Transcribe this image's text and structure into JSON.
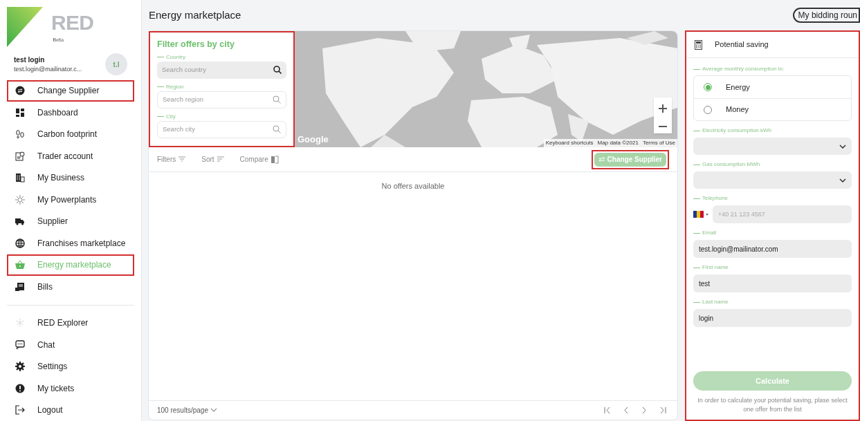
{
  "page_title": "Energy marketplace",
  "bidding_button": "My bidding roun",
  "logo": {
    "text": "RED",
    "subtitle": "Beta"
  },
  "user": {
    "name": "test login",
    "email": "test.login@mailinator.c...",
    "initials": "t.l"
  },
  "nav_sections": [
    {
      "items": [
        {
          "label": "Change Supplier",
          "selected": false,
          "highlighted": true
        },
        {
          "label": "Dashboard",
          "selected": false,
          "highlighted": false
        },
        {
          "label": "Carbon footprint",
          "selected": false,
          "highlighted": false
        },
        {
          "label": "Trader account",
          "selected": false,
          "highlighted": false
        },
        {
          "label": "My Business",
          "selected": false,
          "highlighted": false
        },
        {
          "label": "My Powerplants",
          "selected": false,
          "highlighted": false
        },
        {
          "label": "Supplier",
          "selected": false,
          "highlighted": false
        },
        {
          "label": "Franchises marketplace",
          "selected": false,
          "highlighted": false
        },
        {
          "label": "Energy marketplace",
          "selected": true,
          "highlighted": true
        },
        {
          "label": "Bills",
          "selected": false,
          "highlighted": false
        }
      ]
    },
    {
      "items": [
        {
          "label": "RED Explorer",
          "selected": false,
          "highlighted": false
        },
        {
          "label": "Chat",
          "selected": false,
          "highlighted": false
        },
        {
          "label": "Settings",
          "selected": false,
          "highlighted": false
        },
        {
          "label": "My tickets",
          "selected": false,
          "highlighted": false
        },
        {
          "label": "Logout",
          "selected": false,
          "highlighted": false
        }
      ]
    }
  ],
  "filter": {
    "title": "Filter offers by city",
    "highlighted": true,
    "fields": [
      {
        "label": "Country",
        "placeholder": "Search country",
        "active": true
      },
      {
        "label": "Region",
        "placeholder": "Search region",
        "active": false
      },
      {
        "label": "City",
        "placeholder": "Search city",
        "active": false
      }
    ]
  },
  "map": {
    "logo": "Google",
    "attribution": [
      "Keyboard shortcuts",
      "Map data ©2021",
      "Terms of Use"
    ]
  },
  "toolbar": {
    "items": [
      "Filters",
      "Sort",
      "Compare"
    ],
    "action": {
      "label": "Change Supplier",
      "disabled": true,
      "highlighted": true
    }
  },
  "offers": {
    "empty_message": "No offers available"
  },
  "pagination": {
    "page_size": "100 results/page"
  },
  "saving": {
    "title": "Potential saving",
    "highlighted": true,
    "consumption_label": "Average monthly consumption in:",
    "options": [
      {
        "label": "Energy",
        "selected": true
      },
      {
        "label": "Money",
        "selected": false
      }
    ],
    "fields": [
      {
        "kind": "select",
        "label": "Electricity consumption kWh"
      },
      {
        "kind": "select",
        "label": "Gas consumption MWh"
      },
      {
        "kind": "phone",
        "label": "Telephone",
        "placeholder": "+40 21 123 4567"
      },
      {
        "kind": "text",
        "label": "Email",
        "value": "test.login@mailinator.com"
      },
      {
        "kind": "text",
        "label": "First name",
        "value": "test"
      },
      {
        "kind": "text",
        "label": "Last name",
        "value": "login"
      }
    ],
    "button": {
      "label": "Calculate",
      "disabled": true
    },
    "note": "In order to calculate your potential saving, plase select one offer from the list"
  }
}
